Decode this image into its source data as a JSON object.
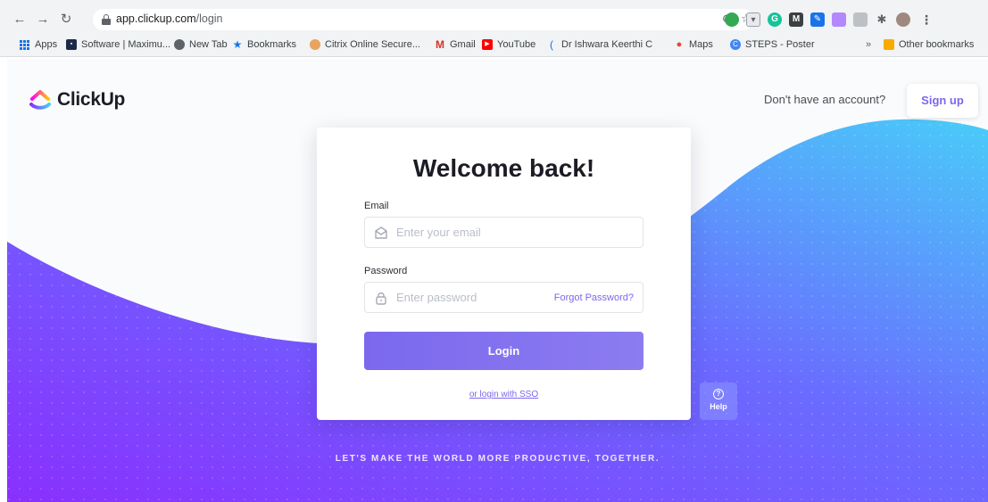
{
  "browser": {
    "url_host": "app.clickup.com",
    "url_path": "/login",
    "bookmarks": [
      {
        "label": "Apps"
      },
      {
        "label": "Software | Maximu..."
      },
      {
        "label": "New Tab"
      },
      {
        "label": "Bookmarks"
      },
      {
        "label": "Citrix Online Secure..."
      },
      {
        "label": "Gmail"
      },
      {
        "label": "YouTube"
      },
      {
        "label": "Dr Ishwara Keerthi C"
      },
      {
        "label": "Maps"
      },
      {
        "label": "STEPS - Poster"
      }
    ],
    "overflow_label": "»",
    "other_bookmarks": "Other bookmarks"
  },
  "header": {
    "logo_text": "ClickUp",
    "signup_prompt": "Don't have an account?",
    "signup_label": "Sign up"
  },
  "login": {
    "title": "Welcome back!",
    "email_label": "Email",
    "email_placeholder": "Enter your email",
    "password_label": "Password",
    "password_placeholder": "Enter password",
    "forgot_label": "Forgot Password?",
    "login_label": "Login",
    "sso_label": "or login with SSO"
  },
  "help": {
    "icon": "?",
    "label": "Help"
  },
  "footer": {
    "tagline": "LET'S MAKE THE WORLD MORE PRODUCTIVE, TOGETHER."
  },
  "colors": {
    "brand": "#7b68ee",
    "gradient_start": "#8930fd",
    "gradient_end": "#49ccf9"
  }
}
